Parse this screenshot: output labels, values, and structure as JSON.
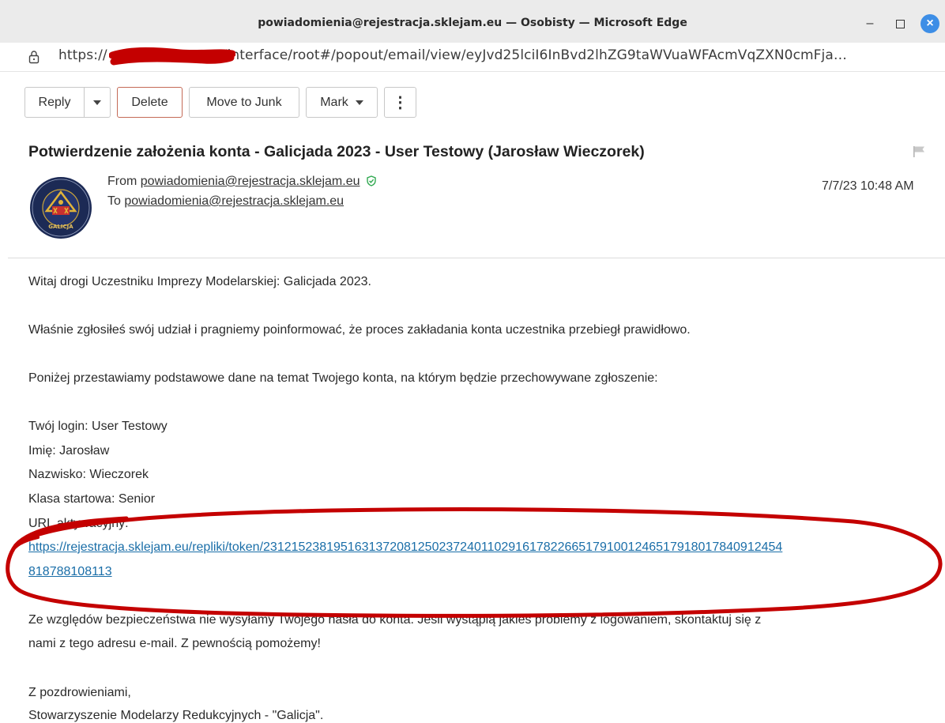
{
  "window": {
    "title": "powiadomienia@rejestracja.sklejam.eu — Osobisty — Microsoft Edge",
    "minimize_glyph": "–",
    "close_glyph": "×"
  },
  "address_bar": {
    "scheme": "https://",
    "url_rest": "/interface/root#/popout/email/view/eyJvd25lciI6InBvd2lhZG9taWVuaWFAcmVqZXN0cmFja…"
  },
  "toolbar": {
    "reply_label": "Reply",
    "delete_label": "Delete",
    "junk_label": "Move to Junk",
    "mark_label": "Mark",
    "more_glyph": "⋮"
  },
  "message": {
    "subject": "Potwierdzenie założenia konta - Galicjada 2023 - User Testowy (Jarosław Wieczorek)",
    "from_label": "From",
    "from_address": "powiadomienia@rejestracja.sklejam.eu",
    "to_label": "To",
    "to_address": "powiadomienia@rejestracja.sklejam.eu",
    "date": "7/7/23 10:48 AM",
    "avatar_text": "GALICJA"
  },
  "body": {
    "greeting": "Witaj drogi Uczestniku Imprezy Modelarskiej: Galicjada 2023.",
    "p1": "Właśnie zgłosiłeś swój udział i pragniemy poinformować, że proces zakładania konta uczestnika przebiegł prawidłowo.",
    "p2": "Poniżej przestawiamy podstawowe dane na temat Twojego konta, na którym będzie przechowywane zgłoszenie:",
    "login": "Twój login: User Testowy",
    "first_name": "Imię: Jarosław",
    "last_name": "Nazwisko: Wieczorek",
    "class": "Klasa startowa: Senior",
    "url_label": "URL aktywacyjny:",
    "activation_url_line1": "https://rejestracja.sklejam.eu/repliki/token/23121523819516313720812502372401102916178226651791001246517918017840912454",
    "activation_url_line2": "818788108113",
    "p3_line1": "Ze względów bezpieczeństwa nie wysyłamy Twojego hasła do konta. Jeśli wystąpią jakieś problemy z logowaniem, skontaktuj się z",
    "p3_line2": "nami z tego adresu e-mail. Z pewnością pomożemy!",
    "closing": "Z pozdrowieniami,",
    "signature": "Stowarzyszenie Modelarzy Redukcyjnych - \"Galicja\"."
  },
  "colors": {
    "annotation_red": "#c40000",
    "link_blue": "#1a6ea8",
    "close_button": "#3d8ee6"
  }
}
